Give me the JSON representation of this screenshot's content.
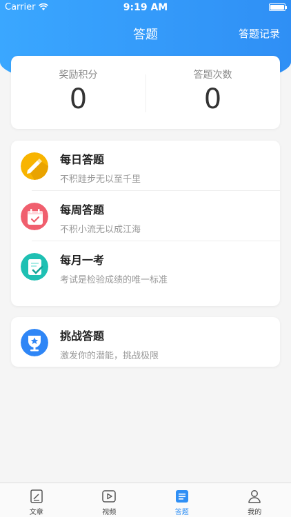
{
  "status_bar": {
    "carrier": "Carrier",
    "time": "9:19 AM"
  },
  "nav": {
    "title": "答题",
    "right_action": "答题记录"
  },
  "stats": [
    {
      "label": "奖励积分",
      "value": "0"
    },
    {
      "label": "答题次数",
      "value": "0"
    }
  ],
  "quiz_list": [
    {
      "title": "每日答题",
      "subtitle": "不积跬步无以至千里",
      "icon": "pencil-icon",
      "color": "#f8b400"
    },
    {
      "title": "每周答题",
      "subtitle": "不积小流无以成江海",
      "icon": "calendar-icon",
      "color": "#f05f6e"
    },
    {
      "title": "每月一考",
      "subtitle": "考试是检验成绩的唯一标准",
      "icon": "clipboard-check-icon",
      "color": "#1fc0b3"
    }
  ],
  "challenge": {
    "title": "挑战答题",
    "subtitle": "激发你的潜能，挑战极限",
    "icon": "trophy-icon",
    "color": "#2f86f6"
  },
  "tabbar": [
    {
      "label": "文章",
      "icon": "article-icon",
      "active": false
    },
    {
      "label": "视频",
      "icon": "video-icon",
      "active": false
    },
    {
      "label": "答题",
      "icon": "quiz-icon",
      "active": true
    },
    {
      "label": "我的",
      "icon": "profile-icon",
      "active": false
    }
  ],
  "colors": {
    "primary": "#2f8ff5",
    "background": "#f5f5f5"
  }
}
